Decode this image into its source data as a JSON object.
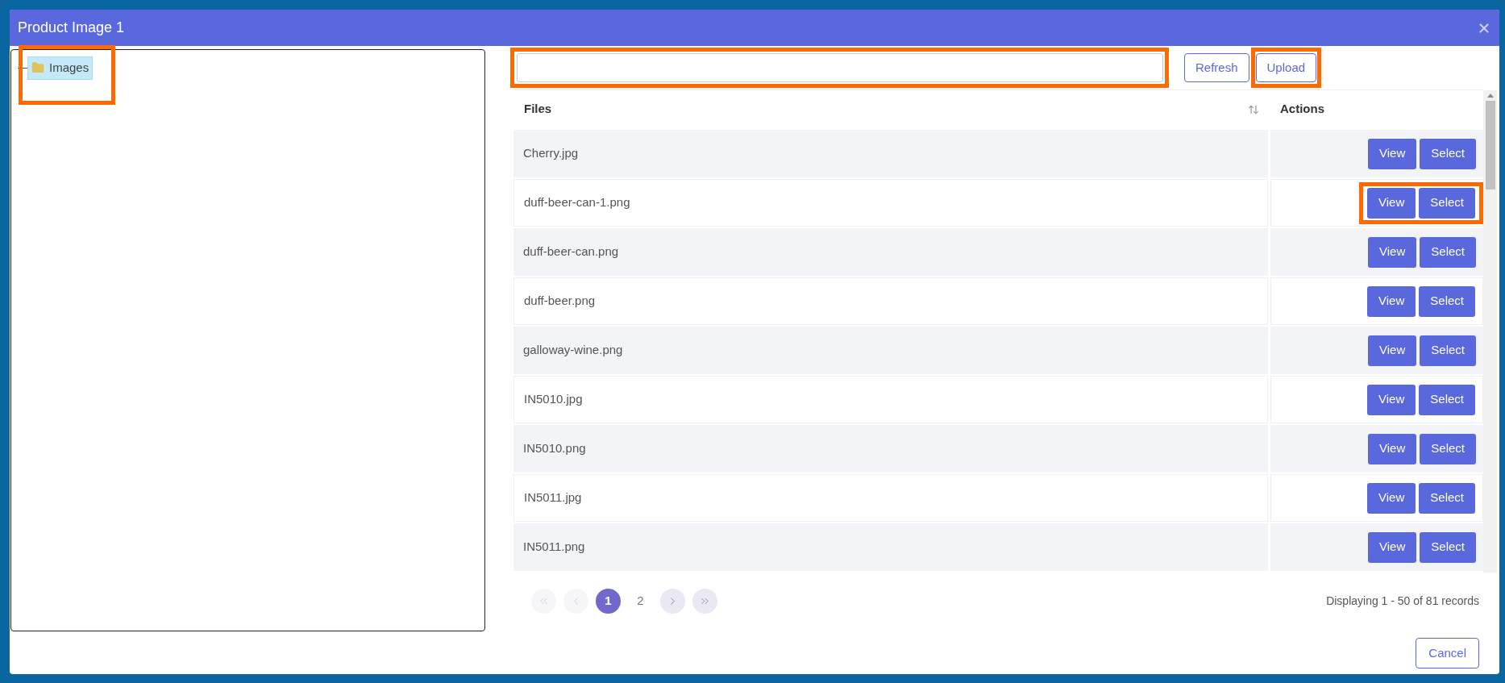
{
  "dialog": {
    "title": "Product Image 1"
  },
  "tree": {
    "items": [
      {
        "label": "Images",
        "selected": true,
        "highlighted": true
      }
    ]
  },
  "search": {
    "highlighted": true
  },
  "toolbar": [
    {
      "label": "Refresh",
      "highlighted": false
    },
    {
      "label": "Upload",
      "highlighted": true
    }
  ],
  "table": {
    "columns": [
      "Files",
      "Actions"
    ],
    "rows": [
      {
        "file": "Cherry.jpg",
        "actions": [
          "View",
          "Select"
        ],
        "highlighted": false
      },
      {
        "file": "duff-beer-can-1.png",
        "actions": [
          "View",
          "Select"
        ],
        "highlighted": true
      },
      {
        "file": "duff-beer-can.png",
        "actions": [
          "View",
          "Select"
        ],
        "highlighted": false
      },
      {
        "file": "duff-beer.png",
        "actions": [
          "View",
          "Select"
        ],
        "highlighted": false
      },
      {
        "file": "galloway-wine.png",
        "actions": [
          "View",
          "Select"
        ],
        "highlighted": false
      },
      {
        "file": "IN5010.jpg",
        "actions": [
          "View",
          "Select"
        ],
        "highlighted": false
      },
      {
        "file": "IN5010.png",
        "actions": [
          "View",
          "Select"
        ],
        "highlighted": false
      },
      {
        "file": "IN5011.jpg",
        "actions": [
          "View",
          "Select"
        ],
        "highlighted": false
      },
      {
        "file": "IN5011.png",
        "actions": [
          "View",
          "Select"
        ],
        "highlighted": false
      }
    ]
  },
  "pagination": {
    "items": [
      {
        "kind": "first",
        "disabled": true
      },
      {
        "kind": "prev",
        "disabled": true
      },
      {
        "kind": "page",
        "label": "1",
        "selected": true
      },
      {
        "kind": "page",
        "label": "2",
        "selected": false
      },
      {
        "kind": "next",
        "disabled": false
      },
      {
        "kind": "last",
        "disabled": false
      }
    ],
    "summary": "Displaying 1 - 50 of 81 records"
  },
  "footer": {
    "buttons": [
      "Cancel"
    ]
  }
}
